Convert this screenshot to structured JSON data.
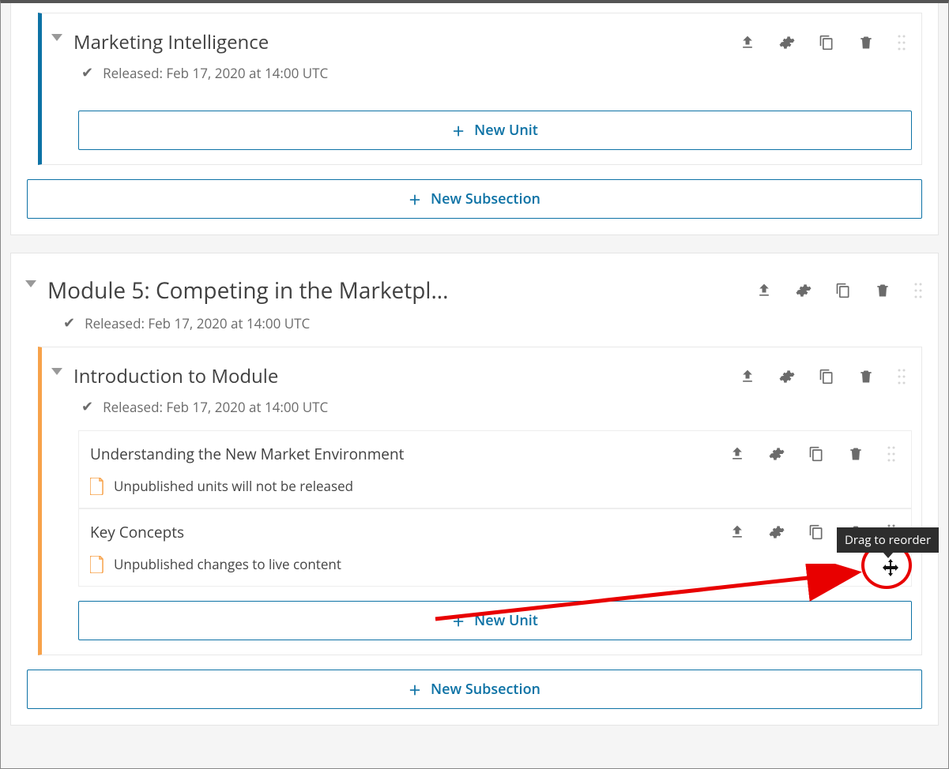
{
  "sections": [
    {
      "title": "Module 5: Competing in the Marketpl...",
      "released": "Released: Feb 17, 2020 at 14:00 UTC",
      "subsections": [
        {
          "title": "Introduction to Module",
          "released": "Released: Feb 17, 2020 at 14:00 UTC",
          "accent": "orange",
          "units": [
            {
              "title": "Understanding the New Market Environment",
              "warning": "Unpublished units will not be released"
            },
            {
              "title": "Key Concepts",
              "warning": "Unpublished changes to live content"
            }
          ]
        }
      ]
    }
  ],
  "top_subsection": {
    "title": "Marketing Intelligence",
    "released": "Released: Feb 17, 2020 at 14:00 UTC"
  },
  "buttons": {
    "new_unit": "New Unit",
    "new_subsection": "New Subsection"
  },
  "tooltip": "Drag to reorder"
}
